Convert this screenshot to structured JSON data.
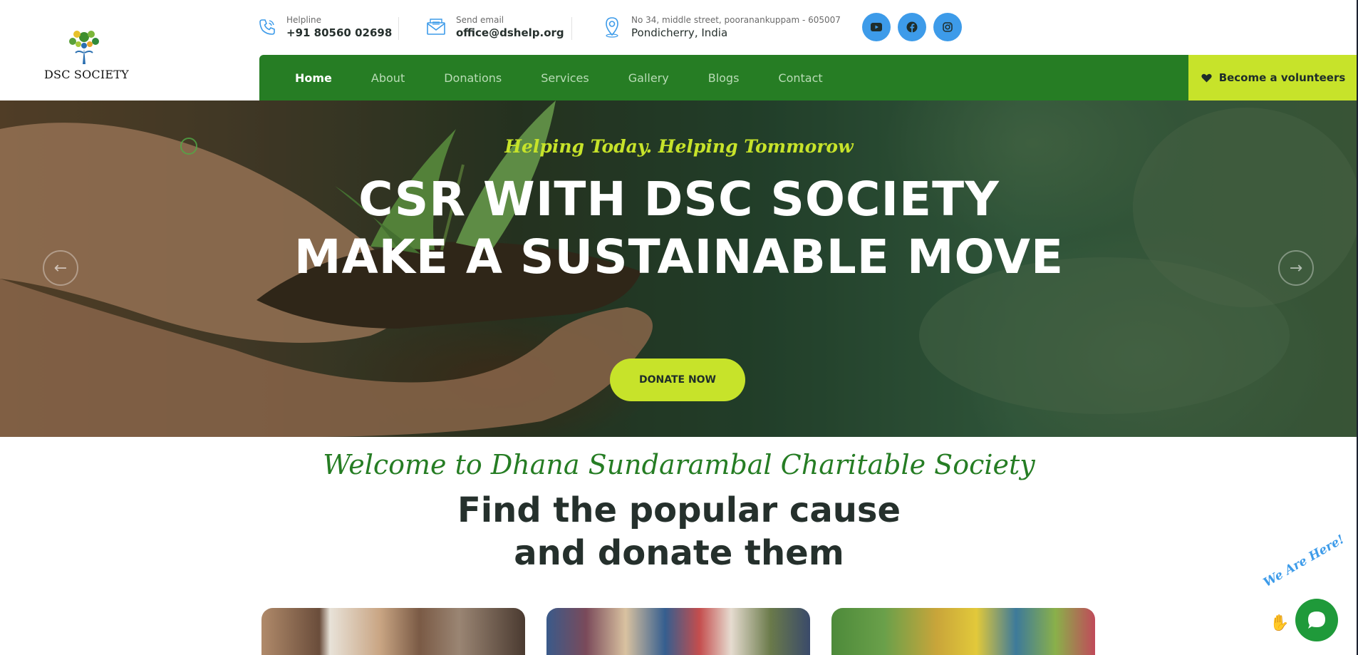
{
  "header": {
    "logo_text": "DSC SOCIETY",
    "contacts": [
      {
        "label": "Helpline",
        "value": "+91 80560 02698",
        "icon": "phone-icon"
      },
      {
        "label": "Send email",
        "value": "office@dshelp.org",
        "icon": "mail-icon"
      },
      {
        "label": "No 34, middle street, pooranankuppam - 605007",
        "value": "Pondicherry, India",
        "icon": "location-pin-icon"
      }
    ],
    "socials": [
      "youtube-icon",
      "facebook-icon",
      "instagram-icon"
    ]
  },
  "nav": {
    "items": [
      "Home",
      "About",
      "Donations",
      "Services",
      "Gallery",
      "Blogs",
      "Contact"
    ],
    "active": "Home",
    "volunteer_label": "Become a volunteers"
  },
  "hero": {
    "tagline": "Helping Today. Helping Tommorow",
    "title_line1": "CSR WITH DSC SOCIETY",
    "title_line2": "MAKE A SUSTAINABLE MOVE",
    "cta": "DONATE NOW",
    "prev_arrow": "←",
    "next_arrow": "→"
  },
  "intro": {
    "welcome": "Welcome to Dhana Sundarambal Charitable Society",
    "headline_line1": "Find the popular cause",
    "headline_line2": "and donate them"
  },
  "chat": {
    "badge": "We Are Here!"
  },
  "colors": {
    "primary_green": "#267d24",
    "accent_lime": "#c7e32a",
    "social_blue": "#3d9be9",
    "chat_green": "#1f9a3a"
  }
}
